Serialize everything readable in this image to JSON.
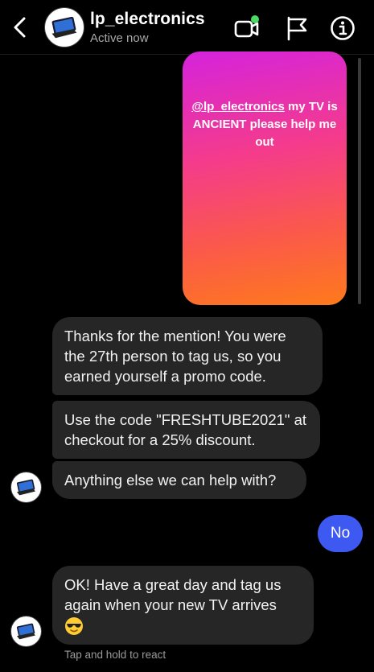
{
  "header": {
    "back_icon": "chevron-left-icon",
    "name": "lp_electronics",
    "status": "Active now",
    "icons": [
      "video-call-icon",
      "flag-icon",
      "info-icon"
    ]
  },
  "story": {
    "mention": "@lp_electronics",
    "text_after_mention": " my TV is ANCIENT please help me out",
    "gradient": [
      "#d523dd",
      "#f43b8c",
      "#fe7a1b"
    ]
  },
  "messages": [
    {
      "from": "lp_electronics",
      "text": "Thanks for the mention! You were the 27th person to tag us, so you earned yourself a promo code."
    },
    {
      "from": "lp_electronics",
      "text": "Use the code \"FRESHTUBE2021\" at checkout for a 25% discount."
    },
    {
      "from": "lp_electronics",
      "text": "Anything else we can help with?"
    },
    {
      "from": "me",
      "text": "No"
    },
    {
      "from": "lp_electronics",
      "text": "OK! Have a great day and tag us again when your new TV arrives",
      "emoji": "sunglasses-emoji-icon"
    }
  ],
  "hint": "Tap and hold to react",
  "colors": {
    "background": "#000000",
    "bubble_them": "#262626",
    "bubble_me": "#3d59f2",
    "active_dot": "#4cd964"
  }
}
